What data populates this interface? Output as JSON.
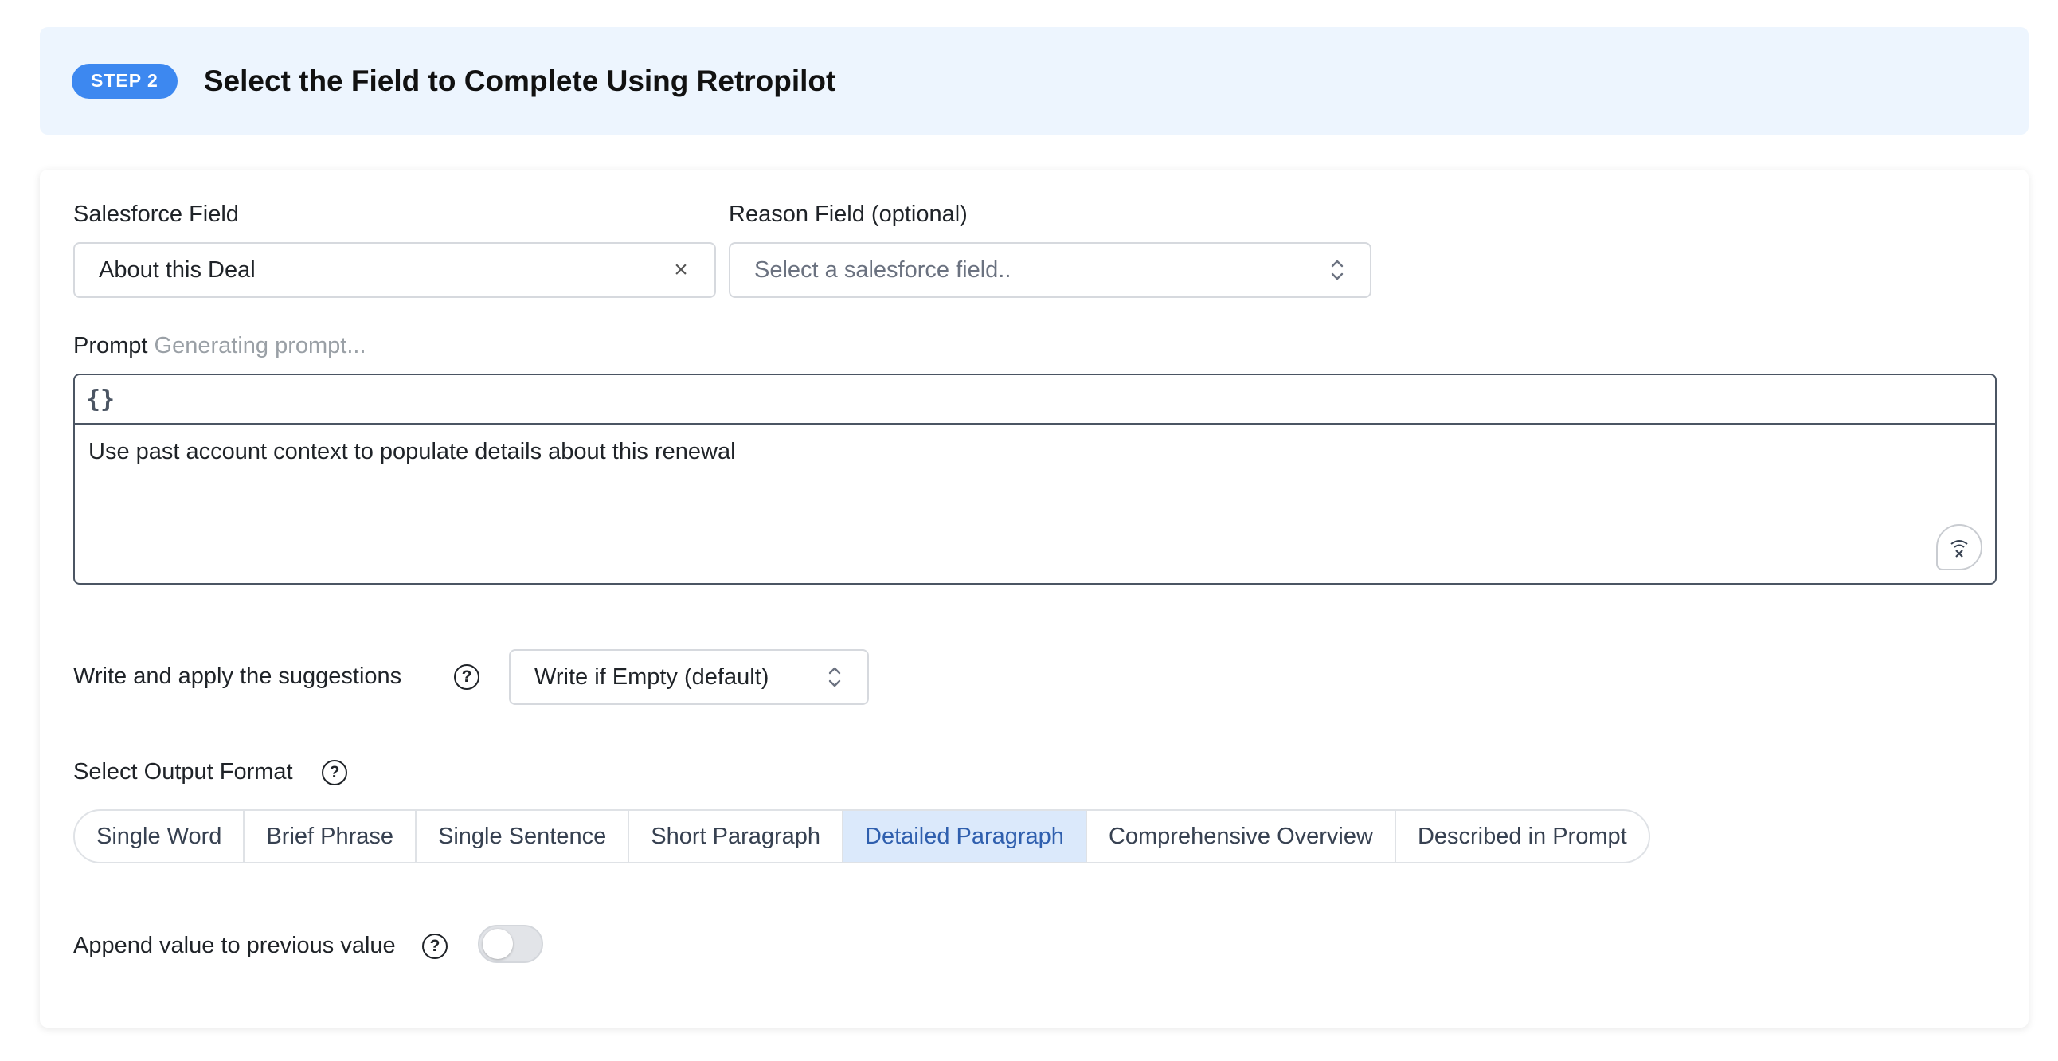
{
  "step": {
    "badge": "STEP 2",
    "title": "Select the Field to Complete Using Retropilot"
  },
  "salesforce_field": {
    "label": "Salesforce Field",
    "value": "About this Deal",
    "clear_glyph": "×"
  },
  "reason_field": {
    "label": "Reason Field (optional)",
    "placeholder": "Select a salesforce field.."
  },
  "prompt": {
    "label": "Prompt",
    "status": "Generating prompt...",
    "toolbar_button": "{}",
    "text": "Use past account context to populate details about this renewal"
  },
  "write_mode": {
    "label": "Write and apply the suggestions",
    "value": "Write if Empty (default)"
  },
  "output_format": {
    "label": "Select Output Format",
    "options": [
      "Single Word",
      "Brief Phrase",
      "Single Sentence",
      "Short Paragraph",
      "Detailed Paragraph",
      "Comprehensive Overview",
      "Described in Prompt"
    ],
    "selected": "Detailed Paragraph"
  },
  "append": {
    "label": "Append value to previous value",
    "enabled": false
  },
  "help_glyph": "?",
  "colors": {
    "accent": "#3d88f0",
    "header_bg": "#edf5fe",
    "selected_bg": "#dbe9fb",
    "selected_text": "#2f5fae"
  },
  "icons": [
    "braces-icon",
    "help-icon",
    "chevron-updown-icon",
    "clear-icon",
    "voice-off-icon"
  ]
}
